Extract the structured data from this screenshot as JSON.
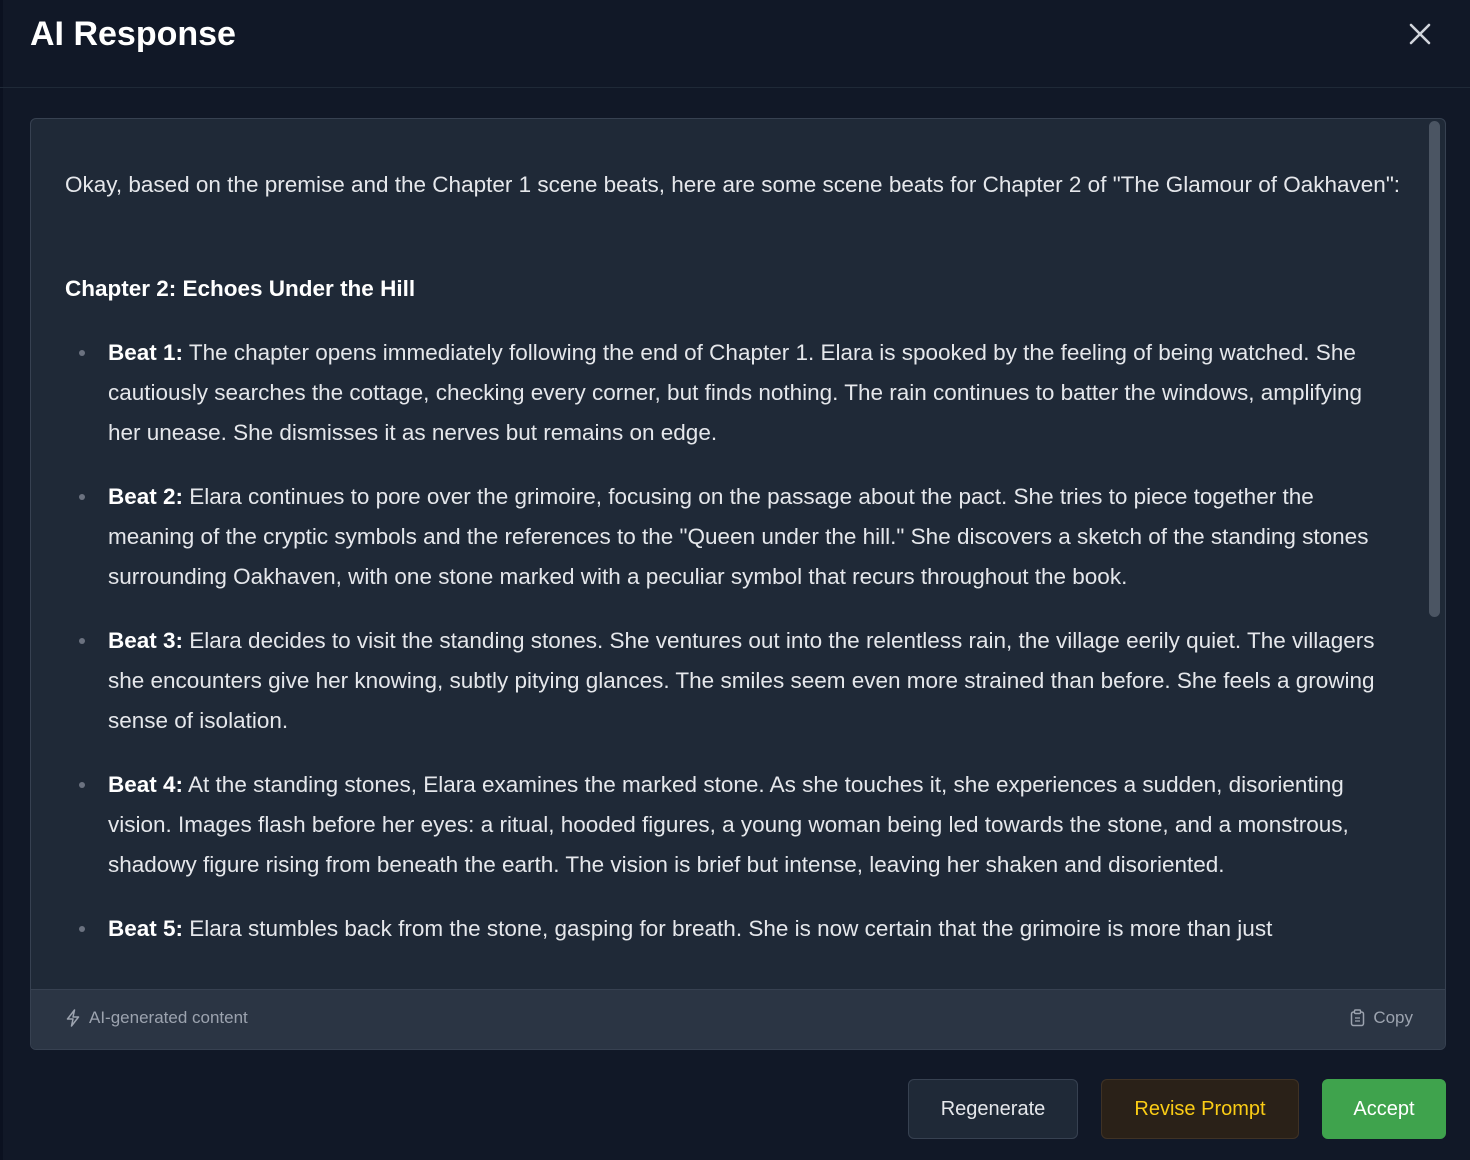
{
  "dialog": {
    "title": "AI Response",
    "close_icon": "close-icon"
  },
  "response": {
    "intro": "Okay, based on the premise and the Chapter 1 scene beats, here are some scene beats for Chapter 2 of \"The Glamour of Oakhaven\":",
    "chapter_heading": "Chapter 2: Echoes Under the Hill",
    "beats": [
      {
        "label": "Beat 1:",
        "text": " The chapter opens immediately following the end of Chapter 1. Elara is spooked by the feeling of being watched. She cautiously searches the cottage, checking every corner, but finds nothing. The rain continues to batter the windows, amplifying her unease. She dismisses it as nerves but remains on edge."
      },
      {
        "label": "Beat 2:",
        "text": " Elara continues to pore over the grimoire, focusing on the passage about the pact. She tries to piece together the meaning of the cryptic symbols and the references to the \"Queen under the hill.\" She discovers a sketch of the standing stones surrounding Oakhaven, with one stone marked with a peculiar symbol that recurs throughout the book."
      },
      {
        "label": "Beat 3:",
        "text": " Elara decides to visit the standing stones. She ventures out into the relentless rain, the village eerily quiet. The villagers she encounters give her knowing, subtly pitying glances. The smiles seem even more strained than before. She feels a growing sense of isolation."
      },
      {
        "label": "Beat 4:",
        "text": " At the standing stones, Elara examines the marked stone. As she touches it, she experiences a sudden, disorienting vision. Images flash before her eyes: a ritual, hooded figures, a young woman being led towards the stone, and a monstrous, shadowy figure rising from beneath the earth. The vision is brief but intense, leaving her shaken and disoriented."
      },
      {
        "label": "Beat 5:",
        "text": " Elara stumbles back from the stone, gasping for breath. She is now certain that the grimoire is more than just"
      }
    ]
  },
  "footer": {
    "ai_tag_icon": "lightning-icon",
    "ai_tag_label": "AI-generated content",
    "copy_icon": "clipboard-icon",
    "copy_label": "Copy"
  },
  "actions": {
    "regenerate_label": "Regenerate",
    "revise_label": "Revise Prompt",
    "accept_label": "Accept"
  },
  "colors": {
    "background": "#111827",
    "panel": "#1f2937",
    "accept": "#3fa34d",
    "revise_text": "#facc15"
  }
}
